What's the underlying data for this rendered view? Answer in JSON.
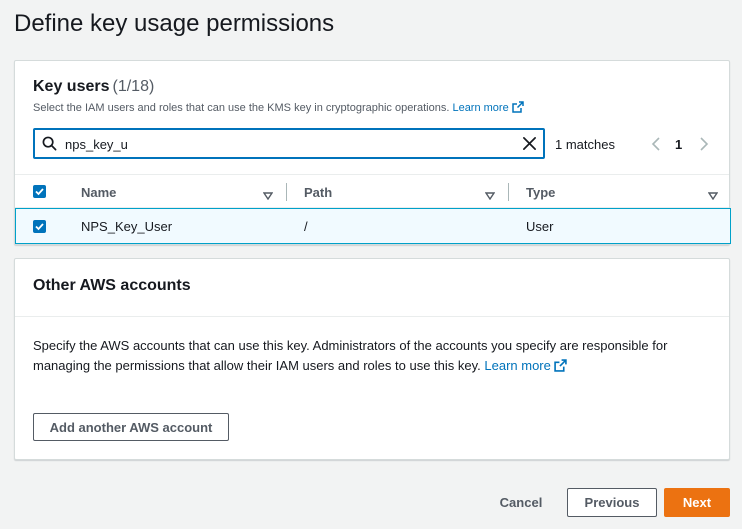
{
  "page": {
    "title": "Define key usage permissions"
  },
  "key_users": {
    "title": "Key users",
    "count": "(1/18)",
    "description": "Select the IAM users and roles that can use the KMS key in cryptographic operations.",
    "learn_more": "Learn more",
    "search": {
      "value": "nps_key_u",
      "placeholder": ""
    },
    "matches": "1 matches",
    "page_number": "1",
    "columns": [
      "Name",
      "Path",
      "Type"
    ],
    "rows": [
      {
        "name": "NPS_Key_User",
        "path": "/",
        "type": "User",
        "selected": true
      }
    ]
  },
  "other_accounts": {
    "title": "Other AWS accounts",
    "description": "Specify the AWS accounts that can use this key. Administrators of the accounts you specify are responsible for managing the permissions that allow their IAM users and roles to use this key.",
    "learn_more": "Learn more",
    "add_button": "Add another AWS account"
  },
  "footer": {
    "cancel": "Cancel",
    "previous": "Previous",
    "next": "Next"
  },
  "colors": {
    "accent": "#0073bb",
    "primary_button": "#ec7211",
    "selected_row_bg": "#f1faff",
    "selected_row_border": "#00a1c9"
  }
}
